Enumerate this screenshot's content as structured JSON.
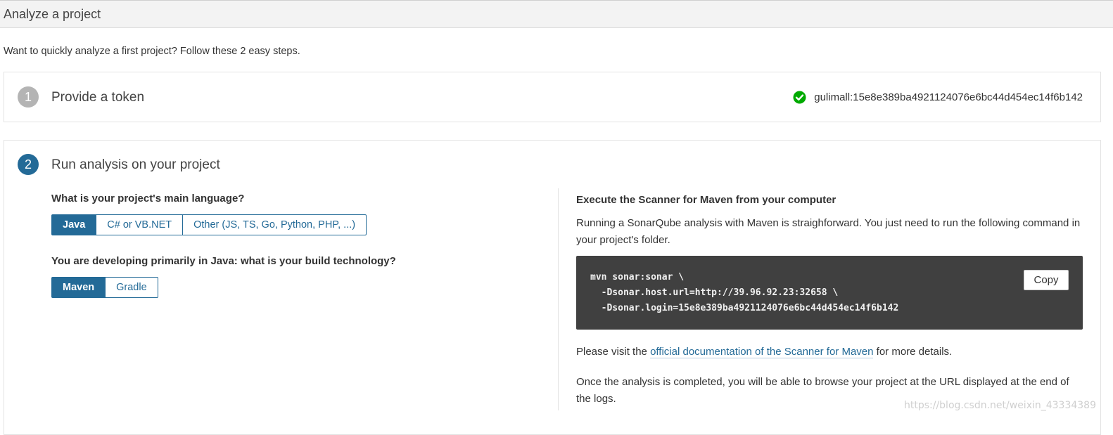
{
  "header": {
    "title": "Analyze a project"
  },
  "intro": "Want to quickly analyze a first project? Follow these 2 easy steps.",
  "step1": {
    "number": "1",
    "title": "Provide a token",
    "token_name": "gulimall",
    "token_separator": ":",
    "token_value": "15e8e389ba4921124076e6bc44d454ec14f6b142",
    "status_icon": "check-circle-icon",
    "status_color": "#00aa00"
  },
  "step2": {
    "number": "2",
    "title": "Run analysis on your project",
    "language_question": "What is your project's main language?",
    "languages": [
      {
        "label": "Java",
        "selected": true
      },
      {
        "label": "C# or VB.NET",
        "selected": false
      },
      {
        "label": "Other (JS, TS, Go, Python, PHP, ...)",
        "selected": false
      }
    ],
    "build_question": "You are developing primarily in Java: what is your build technology?",
    "builds": [
      {
        "label": "Maven",
        "selected": true
      },
      {
        "label": "Gradle",
        "selected": false
      }
    ],
    "execute_title": "Execute the Scanner for Maven from your computer",
    "execute_desc": "Running a SonarQube analysis with Maven is straighforward. You just need to run the following command in your project's folder.",
    "command_lines": [
      "mvn sonar:sonar \\",
      "  -Dsonar.host.url=http://39.96.92.23:32658 \\",
      "  -Dsonar.login=15e8e389ba4921124076e6bc44d454ec14f6b142"
    ],
    "copy_label": "Copy",
    "visit_prefix": "Please visit the ",
    "visit_link": "official documentation of the Scanner for Maven",
    "visit_suffix": " for more details.",
    "completed_text": "Once the analysis is completed, you will be able to browse your project at the URL displayed at the end of the logs."
  },
  "colors": {
    "accent": "#236a97",
    "code_bg": "#404040",
    "step_done": "#b4b4b4"
  },
  "watermark": "https://blog.csdn.net/weixin_43334389"
}
